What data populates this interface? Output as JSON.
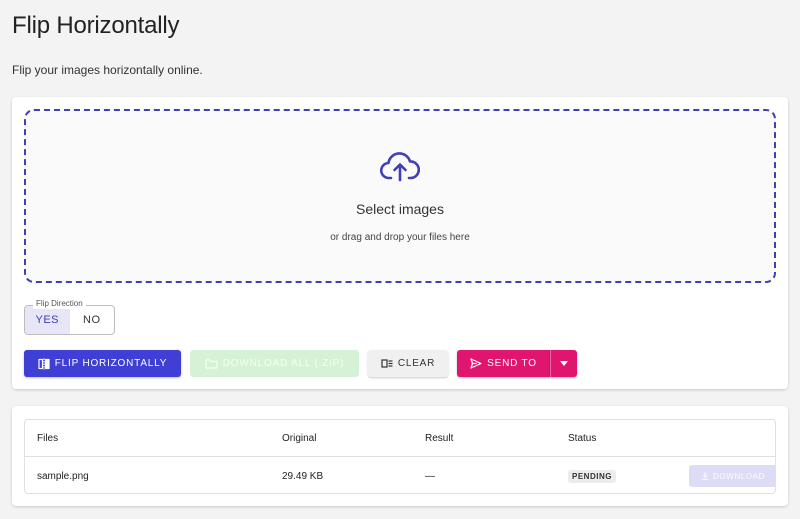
{
  "page": {
    "title": "Flip Horizontally",
    "subtitle": "Flip your images horizontally online."
  },
  "dropzone": {
    "icon": "cloud-upload-icon",
    "title": "Select images",
    "hint": "or drag and drop your files here"
  },
  "flip_direction": {
    "legend": "Flip Direction",
    "options": [
      {
        "label": "YES",
        "selected": true
      },
      {
        "label": "NO",
        "selected": false
      }
    ]
  },
  "actions": {
    "flip_label": "FLIP HORIZONTALLY",
    "download_all_label": "DOWNLOAD ALL (.ZIP)",
    "clear_label": "CLEAR",
    "send_to_label": "SEND TO"
  },
  "files_table": {
    "headers": [
      "Files",
      "Original",
      "Result",
      "Status"
    ],
    "rows": [
      {
        "file": "sample.png",
        "original": "29.49 KB",
        "result": "—",
        "status": "PENDING",
        "download_label": "DOWNLOAD"
      }
    ]
  },
  "colors": {
    "primary": "#3f3fd6",
    "send_to": "#e0156f",
    "download_all_disabled": "#d6f2d6",
    "dropzone_border": "#3f3fb8"
  }
}
